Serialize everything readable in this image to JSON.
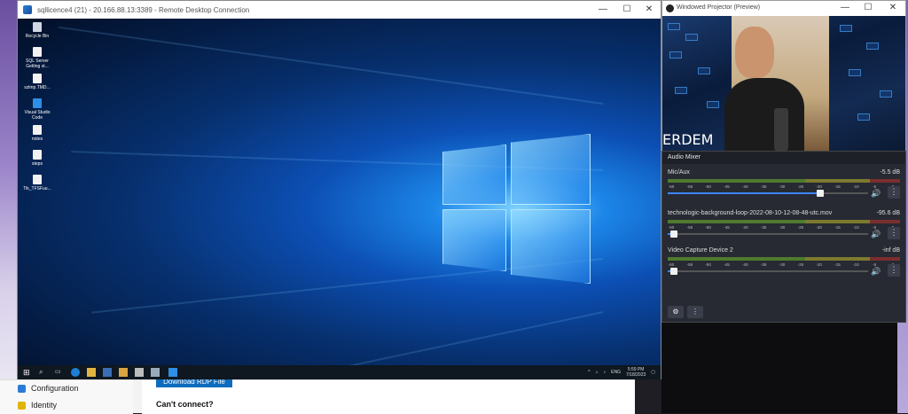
{
  "host": {
    "azure_nav": [
      "Configuration",
      "Identity"
    ],
    "download_label": "Download RDP File",
    "cant_connect": "Can't connect?"
  },
  "rdp": {
    "title": "sqllicence4 (21) - 20.166.88.13:3389 - Remote Desktop Connection",
    "minimize": "—",
    "maximize": "☐",
    "close": "✕",
    "desktop_icons": [
      "Recycle Bin",
      "SQL Server Getting st...",
      "szlmp.TMD...",
      "Visual Studio Code",
      "notes",
      "steps",
      "Tik_TFSFuu..."
    ],
    "taskbar": {
      "lang": "ENG",
      "time": "5:59 PM",
      "date": "7/18/2023"
    }
  },
  "projector": {
    "title": "Windowed Projector (Preview)",
    "minimize": "—",
    "maximize": "☐",
    "close": "✕",
    "overlay_text": "ERDEM"
  },
  "mixer": {
    "title": "Audio Mixer",
    "scale": [
      "-60",
      "-55",
      "-50",
      "-45",
      "-40",
      "-35",
      "-30",
      "-25",
      "-20",
      "-15",
      "-10",
      "-5",
      "0"
    ],
    "channels": [
      {
        "name": "Mic/Aux",
        "db": "-5.5 dB",
        "level_fraction": 0.0,
        "volume_fraction": 0.75
      },
      {
        "name": "technologic-background-loop-2022-08-10-12-08-48-utc.mov",
        "db": "-95.6 dB",
        "level_fraction": 0.0,
        "volume_fraction": 0.02
      },
      {
        "name": "Video Capture Device 2",
        "db": "-inf dB",
        "level_fraction": 0.0,
        "volume_fraction": 0.02
      }
    ],
    "settings_icon": "gear-icon",
    "menu_icon": "kebab-icon"
  }
}
